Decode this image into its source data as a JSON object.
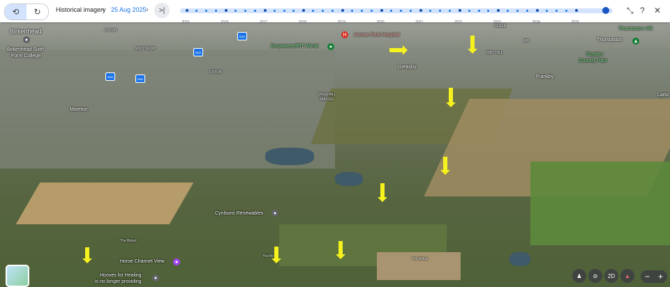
{
  "toolbar": {
    "title": "Historical imagery",
    "prev": "‹",
    "date": "25 Aug 2025",
    "next": "›",
    "end": ">|"
  },
  "timeline": {
    "years": [
      "2015",
      "2016",
      "2017",
      "2018",
      "2019",
      "2020",
      "2021",
      "2022",
      "2023",
      "2024",
      "2025"
    ],
    "selected_year": "2025"
  },
  "map": {
    "places": {
      "birkenhead": "Birkenhead",
      "birkenhead_sixth_1": "Birkenhead Sixth",
      "birkenhead_sixth_2": "Form College",
      "oxton": "OXTON",
      "noctorum": "NOCTORUM",
      "upton": "UPTON",
      "moreton": "Moreton",
      "saughall_1": "SAUGHALL",
      "saughall_2": "MASSIE",
      "arrowe_park": "Arrowe Park Hospital",
      "empowered": "EmpoweredFIT Wirral",
      "greasby": "Greasby",
      "irby_hill": "IRBY HILL",
      "irby": "IRB",
      "pensby": "PENSB",
      "frankby": "Frankby",
      "thurstaston_hill": "Thurstaston Hill",
      "thurstaston": "Thurstaston",
      "royden_1": "Royden",
      "royden_2": "Country Park",
      "larton": "Larto",
      "cynlsons": "Cynlsons Renewables",
      "birket_1": "The Birket",
      "birket_2": "The Birket",
      "birket_3": "The Bir",
      "horse_channel": "Horse Channel View",
      "hooves_1": "Hooves for Healing",
      "hooves_2": "is no longer providing"
    },
    "road_shields": [
      "M53",
      "M53",
      "M53",
      "M53"
    ]
  },
  "controls": {
    "pegman": "person-icon",
    "no_imagery": "no-imagery-icon",
    "view_2d": "2D",
    "compass": "compass-icon",
    "zoom_out": "−",
    "zoom_in": "+"
  },
  "colors": {
    "accent": "#1a73e8",
    "arrow": "#f6f21e",
    "green_label": "#7ee08a"
  }
}
